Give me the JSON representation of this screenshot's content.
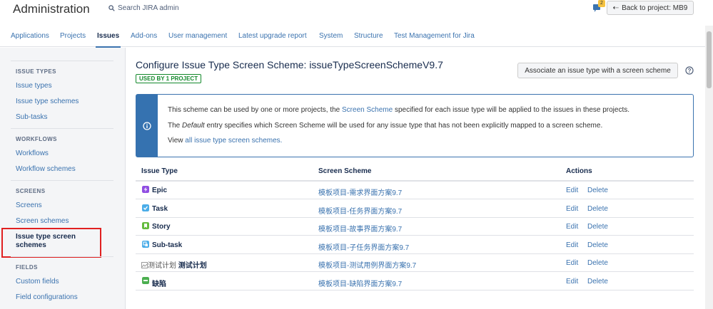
{
  "header": {
    "title": "Administration",
    "search_placeholder": "Search JIRA admin",
    "notification_count": "2",
    "back_button": "Back to project: MB9"
  },
  "nav": {
    "tabs": [
      {
        "label": "Applications"
      },
      {
        "label": "Projects"
      },
      {
        "label": "Issues",
        "active": true
      },
      {
        "label": "Add-ons"
      },
      {
        "label": "User management"
      },
      {
        "label": "Latest upgrade report"
      },
      {
        "label": "System"
      },
      {
        "label": "Structure"
      },
      {
        "label": "Test Management for Jira"
      }
    ]
  },
  "sidebar": {
    "sections": [
      {
        "heading": "ISSUE TYPES",
        "items": [
          "Issue types",
          "Issue type schemes",
          "Sub-tasks"
        ]
      },
      {
        "heading": "WORKFLOWS",
        "items": [
          "Workflows",
          "Workflow schemes"
        ]
      },
      {
        "heading": "SCREENS",
        "items": [
          "Screens",
          "Screen schemes",
          "Issue type screen schemes"
        ]
      },
      {
        "heading": "FIELDS",
        "items": [
          "Custom fields",
          "Field configurations"
        ]
      }
    ],
    "active_item": "Issue type screen schemes"
  },
  "main": {
    "title": "Configure Issue Type Screen Scheme: issueTypeScreenSchemeV9.7",
    "used_by": "USED BY 1 PROJECT",
    "associate_button": "Associate an issue type with a screen scheme",
    "info": {
      "line1_pre": "This scheme can be used by one or more projects, the ",
      "line1_link": "Screen Scheme",
      "line1_post": " specified for each issue type will be applied to the issues in these projects.",
      "line2_pre": "The ",
      "line2_em": "Default",
      "line2_post": " entry specifies which Screen Scheme will be used for any issue type that has not been explicitly mapped to a screen scheme.",
      "line3_pre": "View ",
      "line3_link": "all issue type screen schemes."
    },
    "table": {
      "headers": {
        "issue_type": "Issue Type",
        "screen_scheme": "Screen Scheme",
        "actions": "Actions"
      },
      "edit_label": "Edit",
      "delete_label": "Delete",
      "rows": [
        {
          "issue_type": "Epic",
          "icon": "epic-icon",
          "color": "#904ee2",
          "screen_scheme": "模板项目-需求界面方案9.7"
        },
        {
          "issue_type": "Task",
          "icon": "task-icon",
          "color": "#4bade8",
          "screen_scheme": "模板项目-任务界面方案9.7"
        },
        {
          "issue_type": "Story",
          "icon": "story-icon",
          "color": "#63ba3c",
          "screen_scheme": "模板项目-故事界面方案9.7"
        },
        {
          "issue_type": "Sub-task",
          "icon": "subtask-icon",
          "color": "#4bade8",
          "screen_scheme": "模板项目-子任务界面方案9.7"
        },
        {
          "issue_type": "测试计划",
          "icon_alt": "测试计划",
          "icon": "broken-image-icon",
          "screen_scheme": "模板项目-测试用例界面方案9.7"
        },
        {
          "issue_type": "缺陷",
          "icon": "bug-icon",
          "color": "#4caf50",
          "screen_scheme": "模板项目-缺陷界面方案9.7"
        }
      ]
    }
  }
}
